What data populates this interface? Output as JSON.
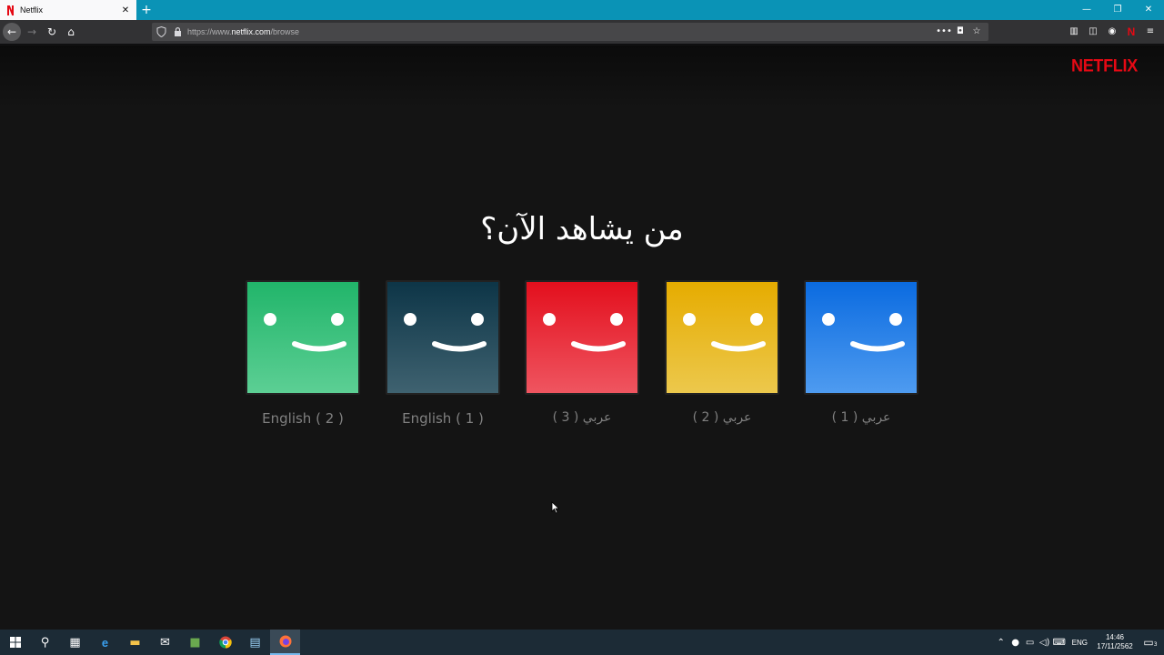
{
  "browser": {
    "tab_title": "Netflix",
    "tab_close": "✕",
    "new_tab": "+",
    "url_prefix": "https://www.",
    "url_host": "netflix.com",
    "url_path": "/browse",
    "window_minimize": "—",
    "window_restore": "❐",
    "window_close": "✕",
    "toolbar_netflix": "N"
  },
  "page": {
    "logo": "NETFLIX",
    "title": "من يشاهد الآن؟",
    "profiles": [
      {
        "name": "English ( 2 )",
        "color_top": "#21b56a",
        "color_bottom": "#5ccf94"
      },
      {
        "name": "English ( 1 )",
        "color_top": "#0d3547",
        "color_bottom": "#3f6270"
      },
      {
        "name": "عربي ( 3 )",
        "color_top": "#e30f1d",
        "color_bottom": "#ef5560"
      },
      {
        "name": "عربي ( 2 )",
        "color_top": "#e6ac00",
        "color_bottom": "#ecc84c"
      },
      {
        "name": "عربي ( 1 )",
        "color_top": "#0b6be0",
        "color_bottom": "#4e9bf0"
      }
    ]
  },
  "taskbar": {
    "language": "ENG",
    "time": "14:46",
    "date": "17/11/2562",
    "notifications": "3"
  },
  "colors": {
    "brand": "#e50914",
    "background": "#141414",
    "profile_label": "#808080"
  }
}
